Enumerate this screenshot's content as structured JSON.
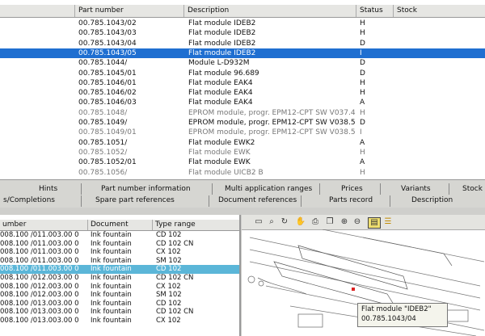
{
  "top_table": {
    "headers": {
      "part_number": "Part number",
      "description": "Description",
      "status": "Status",
      "stock": "Stock"
    },
    "rows": [
      {
        "pn": "00.785.1043/02",
        "desc": "Flat module IDEB2",
        "st": "H"
      },
      {
        "pn": "00.785.1043/03",
        "desc": "Flat module IDEB2",
        "st": "H"
      },
      {
        "pn": "00.785.1043/04",
        "desc": "Flat module IDEB2",
        "st": "D"
      },
      {
        "pn": "00.785.1043/05",
        "desc": "Flat module IDEB2",
        "st": "I"
      },
      {
        "pn": "00.785.1044/",
        "desc": "Module L-D932M",
        "st": "D"
      },
      {
        "pn": "00.785.1045/01",
        "desc": "Flat module 96.689",
        "st": "D"
      },
      {
        "pn": "00.785.1046/01",
        "desc": "Flat module EAK4",
        "st": "H"
      },
      {
        "pn": "00.785.1046/02",
        "desc": "Flat module EAK4",
        "st": "H"
      },
      {
        "pn": "00.785.1046/03",
        "desc": "Flat module EAK4",
        "st": "A"
      },
      {
        "pn": "00.785.1048/",
        "desc": "EPROM module, progr. EPM12-CPT SW V037.4",
        "st": "H"
      },
      {
        "pn": "00.785.1049/",
        "desc": "EPROM module, progr. EPM12-CPT SW V038.5",
        "st": "D"
      },
      {
        "pn": "00.785.1049/01",
        "desc": "EPROM module, progr. EPM12-CPT SW V038.5",
        "st": "I"
      },
      {
        "pn": "00.785.1051/",
        "desc": "Flat module EWK2",
        "st": "A"
      },
      {
        "pn": "00.785.1052/",
        "desc": "Flat module EWK",
        "st": "H"
      },
      {
        "pn": "00.785.1052/01",
        "desc": "Flat module EWK",
        "st": "A"
      },
      {
        "pn": "00.785.1056/",
        "desc": "Flat module UICB2 B",
        "st": "H"
      }
    ]
  },
  "tabs": {
    "row1": [
      "Hints",
      "Part number information",
      "Multi application ranges",
      "Prices",
      "Variants",
      "Stock"
    ],
    "row2": [
      "s/Completions",
      "Spare part references",
      "Document references",
      "Parts record",
      "Description"
    ]
  },
  "bottom_table": {
    "headers": {
      "number": "umber",
      "document": "Document",
      "type_range": "Type range"
    },
    "rows": [
      {
        "num": "008.100 /011.003.00 0",
        "doc": "Ink fountain",
        "type": "CD 102"
      },
      {
        "num": "008.100 /011.003.00 0",
        "doc": "Ink fountain",
        "type": "CD 102 CN"
      },
      {
        "num": "008.100 /011.003.00 0",
        "doc": "Ink fountain",
        "type": "CX 102"
      },
      {
        "num": "008.100 /011.003.00 0",
        "doc": "Ink fountain",
        "type": "SM 102"
      },
      {
        "num": "008.100 /011.003.00 0",
        "doc": "Ink fountain",
        "type": "CD 102"
      },
      {
        "num": "008.100 /012.003.00 0",
        "doc": "Ink fountain",
        "type": "CD 102 CN"
      },
      {
        "num": "008.100 /012.003.00 0",
        "doc": "Ink fountain",
        "type": "CX 102"
      },
      {
        "num": "008.100 /012.003.00 0",
        "doc": "Ink fountain",
        "type": "SM 102"
      },
      {
        "num": "008.100 /013.003.00 0",
        "doc": "Ink fountain",
        "type": "CD 102"
      },
      {
        "num": "008.100 /013.003.00 0",
        "doc": "Ink fountain",
        "type": "CD 102 CN"
      },
      {
        "num": "008.100 /013.003.00 0",
        "doc": "Ink fountain",
        "type": "CX 102"
      }
    ]
  },
  "drawing": {
    "callout_title": "Flat module \"IDEB2\"",
    "callout_pn": "00.785.1043/04",
    "toolbar_icons": [
      "select-icon",
      "zoom-icon",
      "rotate-icon",
      "hand-icon",
      "print-icon",
      "copy-icon",
      "zoom-in-icon",
      "zoom-out-icon",
      "page-icon",
      "highlight-icon"
    ]
  },
  "colors": {
    "selection": "#1f6fd1",
    "bottom_selection": "#5bb6d8"
  }
}
